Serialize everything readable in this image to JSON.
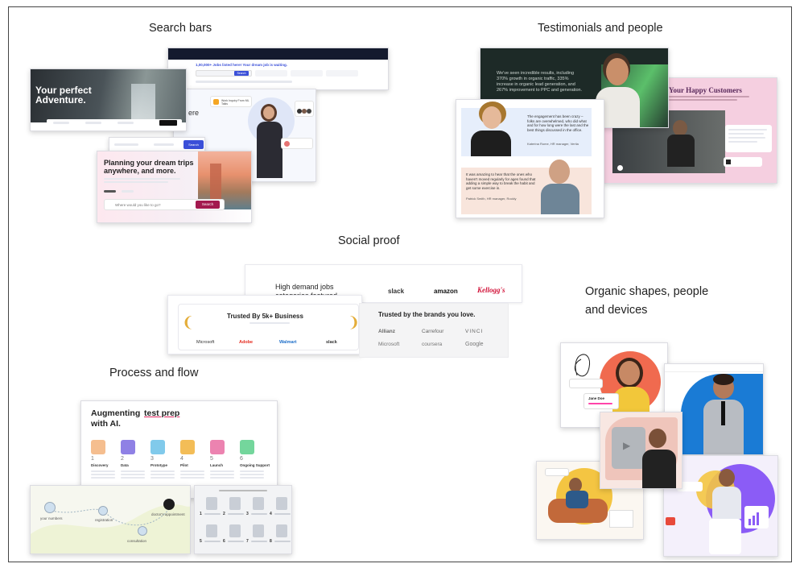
{
  "headings": {
    "search": "Search bars",
    "testimonials": "Testimonials and people",
    "social": "Social proof",
    "organic_line1": "Organic shapes, people",
    "organic_line2": "and devices",
    "process": "Process and flow"
  },
  "search_bars": {
    "jobs_headline": "1,00,000+ Jobs listed here! Your dream job is waiting.",
    "jobs_search": "Search",
    "adventure_title_line1": "Your perfect",
    "adventure_title_line2": "Adventure.",
    "hiring_partial": "ere",
    "job_card": "Work Inquiry From ML Talks",
    "search_button": "Search",
    "trips_title_line1": "Planning your dream trips",
    "trips_title_line2": "anywhere, and more.",
    "trips_placeholder": "Where would you like to go?",
    "trips_button": "Search"
  },
  "testimonials": {
    "dark_quote": "We've seen incredible results, including 370% growth in organic traffic, 335% increase in organic lead generation, and 267% improvement to PPC and generation.",
    "quote1": "The engagement has been crazy – folks are overwhelmed, who did what and for how long were the last and the best things discussed in the office.",
    "person1": "Katerina Rome, HR manager, Vertia",
    "quote2": "It was amazing to hear that the ones who haven't moved regularly for ages found that adding a simple way to break the habit and get some exercise in.",
    "person2": "Patrick Smith, HR manager, Rockly",
    "happy_title": "Your Happy Customers"
  },
  "social_proof": {
    "high_demand_line1": "High demand jobs",
    "high_demand_line2": "categories featured",
    "top_brands": [
      "slack",
      "amazon",
      "Kellogg's"
    ],
    "trusted_5k": "Trusted By 5k+ Business",
    "trusted_5k_brands": [
      "Microsoft",
      "Adobe",
      "Walmart",
      "slack"
    ],
    "trusted_brands_title": "Trusted by the brands you love.",
    "brand_grid": [
      "Allianz",
      "Carrefour",
      "VINCI",
      "Microsoft",
      "coursera",
      "Google"
    ]
  },
  "process": {
    "title_prefix": "Augmenting",
    "title_highlight": "test prep",
    "title_suffix": "with AI.",
    "steps": [
      {
        "num": "1",
        "label": "Discovery"
      },
      {
        "num": "2",
        "label": "Data"
      },
      {
        "num": "3",
        "label": "Prototype"
      },
      {
        "num": "4",
        "label": "Pilot"
      },
      {
        "num": "5",
        "label": "Launch"
      },
      {
        "num": "6",
        "label": "Ongoing Support"
      }
    ],
    "flow_nodes": [
      "your numbers",
      "registration",
      "doctor's appointment",
      "consultation"
    ]
  },
  "organic": {
    "name_card": "Jane Doe",
    "shape_colors": [
      "#f06a4f",
      "#1a7bd5",
      "#f4c542",
      "#8b5cf6"
    ]
  },
  "colors": {
    "jobs_blue": "#3a4fd8",
    "trips_button": "#a3194f",
    "happy_pink": "#f5cfe0",
    "dark_green": "#1d2a27"
  }
}
